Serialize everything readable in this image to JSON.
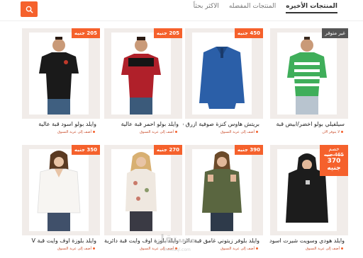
{
  "nav": {
    "tabs": [
      {
        "label": "المنتجات الأخيره",
        "active": true
      },
      {
        "label": "المنتجات المفضله",
        "active": false
      },
      {
        "label": "الاكثر بحثاً",
        "active": false
      }
    ],
    "search_icon": "search-icon"
  },
  "products": [
    {
      "title": "سيلفيلي بولو اخضر/ابيض قبة",
      "badge": "غير متوفر",
      "cart": "لا يتوفر الان",
      "shirt_color": "#3fae5a",
      "shirt_stripe": "#ffffff"
    },
    {
      "title": "بريتش هاوس كنزة صوفية ازرق قبة",
      "price": "450 جنيه",
      "cart": "أضف إلى عربة التسوق",
      "shirt_color": "#2b5fa8"
    },
    {
      "title": "وايلد بولو احمر قبة عالية",
      "price": "205 جنيه",
      "cart": "أضف إلى عربة التسوق",
      "shirt_color": "#b0202a"
    },
    {
      "title": "وايلد بولو اسود قبة عالية",
      "price": "205 جنيه",
      "cart": "أضف إلى عربة التسوق",
      "shirt_color": "#1a1a1a"
    },
    {
      "title": "وايلد هودي وسويت شيرت اسود قبة",
      "sale_label": "خصم",
      "old_price": "465 جنيه",
      "price": "370 جنيه",
      "cart": "أضف إلى عربة التسوق",
      "shirt_color": "#1c1c1c"
    },
    {
      "title": "وايلد بلوفر زيتوني غامق قبة دائرية",
      "price": "390 جنيه",
      "cart": "أضف إلى عربة التسوق",
      "shirt_color": "#5a6640"
    },
    {
      "title": "وايلد بلوزة اوف وايت قبة دائرية",
      "price": "270 جنيه",
      "cart": "أضف إلى عربة التسوق",
      "shirt_color": "#efe8e0"
    },
    {
      "title": "وايلد بلوزة اوف وايت قبة V",
      "price": "350 جنيه",
      "cart": "أضف إلى عربة التسوق",
      "shirt_color": "#f7f5f2"
    }
  ],
  "watermark": {
    "text": "مستقل",
    "sub": "mostaql.com"
  },
  "colors": {
    "accent": "#f5612c",
    "panel": "#f1ece9"
  }
}
